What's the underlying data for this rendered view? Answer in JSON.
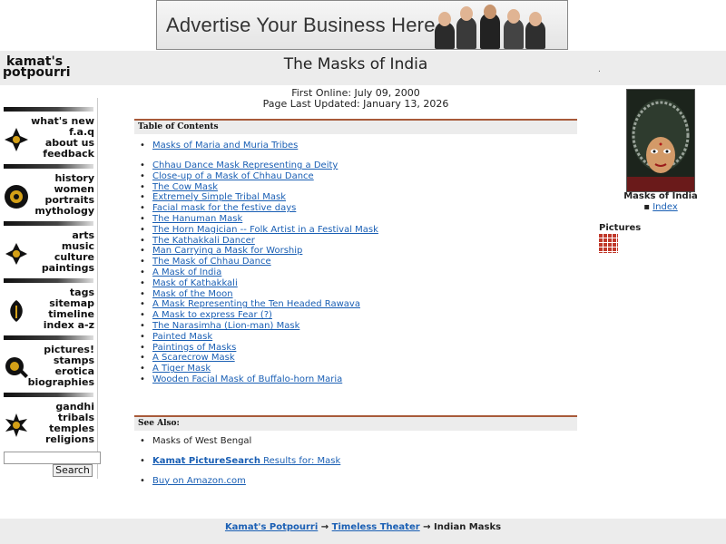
{
  "ad": {
    "text": "Advertise Your Business Here"
  },
  "header": {
    "logo_line1": "kamat's",
    "logo_line2": "potpourri",
    "title": "The Masks of India",
    "dot": "."
  },
  "nav": {
    "groups": [
      {
        "icon": "navigation-emblem-icon",
        "links": [
          "what's new",
          "f.a.q",
          "about us",
          "feedback"
        ]
      },
      {
        "icon": "sun-emblem-icon",
        "links": [
          "history",
          "women",
          "portraits",
          "mythology"
        ]
      },
      {
        "icon": "lotus-emblem-icon",
        "links": [
          "arts",
          "music",
          "culture",
          "paintings"
        ]
      },
      {
        "icon": "leaf-emblem-icon",
        "links": [
          "tags",
          "sitemap",
          "timeline",
          "index a-z"
        ]
      },
      {
        "icon": "lens-emblem-icon",
        "links": [
          "pictures!",
          "stamps",
          "erotica",
          "biographies"
        ]
      },
      {
        "icon": "flower-emblem-icon",
        "links": [
          "gandhi",
          "tribals",
          "temples",
          "religions"
        ]
      }
    ],
    "search_button": "Search"
  },
  "dates": {
    "first_online": "First Online: July 09, 2000",
    "last_updated": "Page Last Updated: January 13, 2026"
  },
  "toc": {
    "heading": "Table of Contents",
    "first": "Masks of Maria and Muria Tribes",
    "items": [
      "Chhau Dance Mask Representing a Deity",
      "Close-up of a Mask of Chhau Dance",
      "The Cow Mask",
      "Extremely Simple Tribal Mask",
      "Facial mask for the festive days",
      "The Hanuman Mask",
      "The Horn Magician -- Folk Artist in a Festival Mask",
      "The Kathakkali Dancer",
      "Man Carrying a Mask for Worship",
      "The Mask of Chhau Dance",
      "A Mask of India",
      "Mask of Kathakkali",
      "Mask of the Moon",
      "A Mask Representing the Ten Headed Rawava",
      "A Mask to express Fear (?)",
      "The Narasimha (Lion-man) Mask",
      "Painted Mask",
      "Paintings of Masks",
      "A Scarecrow Mask",
      "A Tiger Mask",
      "Wooden Facial Mask of Buffalo-horn Maria"
    ]
  },
  "see_also": {
    "heading": "See Also:",
    "item1": "Masks of West Bengal",
    "item2_link": "Kamat PictureSearch",
    "item2_text": " Results for: Mask",
    "item3": "Buy on Amazon.com"
  },
  "right": {
    "caption": "Masks of India",
    "index_link": "Index",
    "pictures_label": "Pictures"
  },
  "footer": {
    "crumb1": "Kamat's Potpourri",
    "crumb2": "Timeless Theater",
    "current": "Indian Masks",
    "sep": "→"
  }
}
